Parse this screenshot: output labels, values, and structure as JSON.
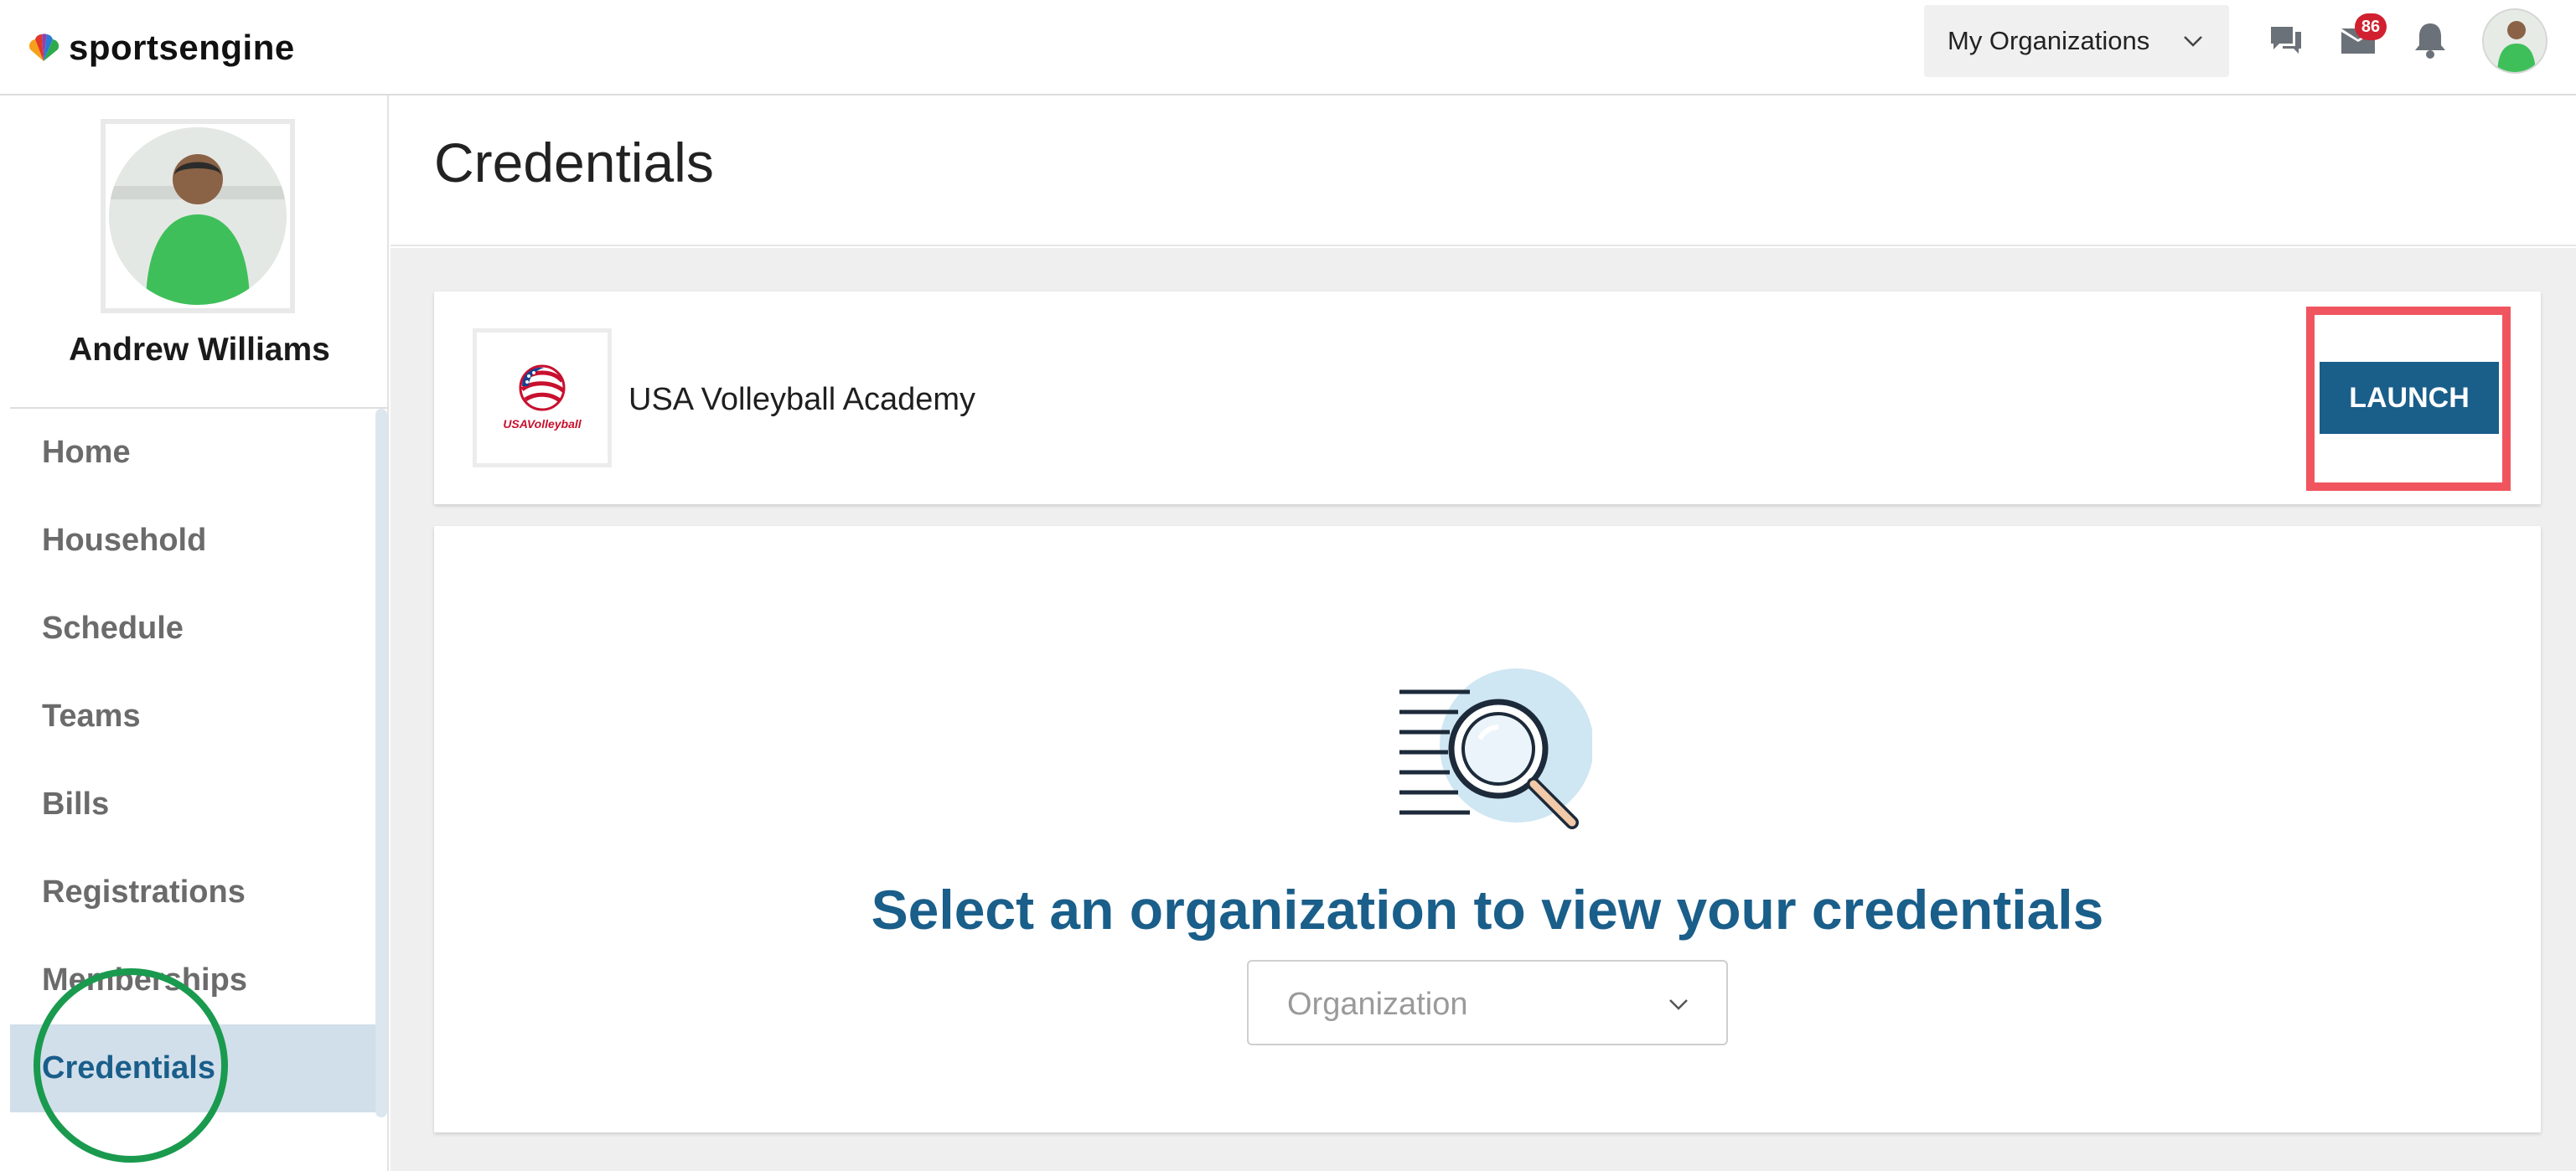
{
  "brand": {
    "logo_text": "sportsengine"
  },
  "header": {
    "org_switcher_label": "My Organizations",
    "mail_badge": "86",
    "icons": [
      "chat-icon",
      "mail-icon",
      "bell-icon"
    ]
  },
  "profile": {
    "name": "Andrew Williams"
  },
  "nav": {
    "items": [
      {
        "label": "Home"
      },
      {
        "label": "Household"
      },
      {
        "label": "Schedule"
      },
      {
        "label": "Teams"
      },
      {
        "label": "Bills"
      },
      {
        "label": "Registrations"
      },
      {
        "label": "Memberships"
      },
      {
        "label": "Credentials"
      }
    ],
    "active": "Credentials"
  },
  "page": {
    "title": "Credentials"
  },
  "org_card": {
    "name": "USA Volleyball Academy",
    "logo_text": "USAVolleyball",
    "launch_label": "LAUNCH"
  },
  "empty_state": {
    "heading": "Select an organization to view your credentials",
    "dropdown_placeholder": "Organization"
  },
  "colors": {
    "brand_blue": "#1a5e8a",
    "annotation_red": "#f0555f",
    "annotation_green": "#1a9a4e",
    "badge_red": "#d1202f"
  }
}
